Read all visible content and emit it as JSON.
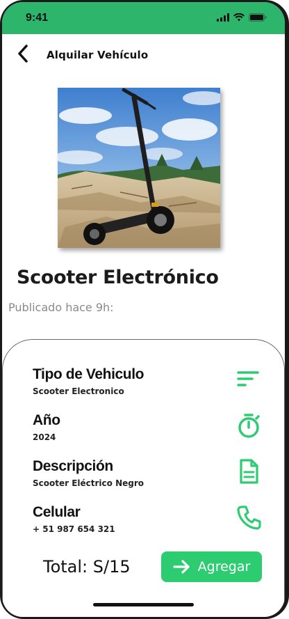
{
  "status_bar": {
    "time": "9:41"
  },
  "header": {
    "title": "Alquilar Vehículo",
    "back_icon": "chevron-left-icon"
  },
  "vehicle": {
    "name": "Scooter Electrónico",
    "published": "Publicado hace 9h:"
  },
  "details": [
    {
      "label": "Tipo de Vehiculo",
      "value": "Scooter Electronico",
      "icon": "filter-lines-icon"
    },
    {
      "label": "Año",
      "value": "2024",
      "icon": "stopwatch-icon"
    },
    {
      "label": "Descripción",
      "value": "Scooter Eléctrico Negro",
      "icon": "document-icon"
    },
    {
      "label": "Celular",
      "value": "+ 51 987 654 321",
      "icon": "phone-icon"
    }
  ],
  "footer": {
    "total": "Total: S/15",
    "add_label": "Agregar",
    "add_icon": "arrow-right-icon"
  },
  "colors": {
    "accent": "#2ecc71",
    "status_bar": "#2db56b",
    "icon_green": "#2ecc71"
  }
}
